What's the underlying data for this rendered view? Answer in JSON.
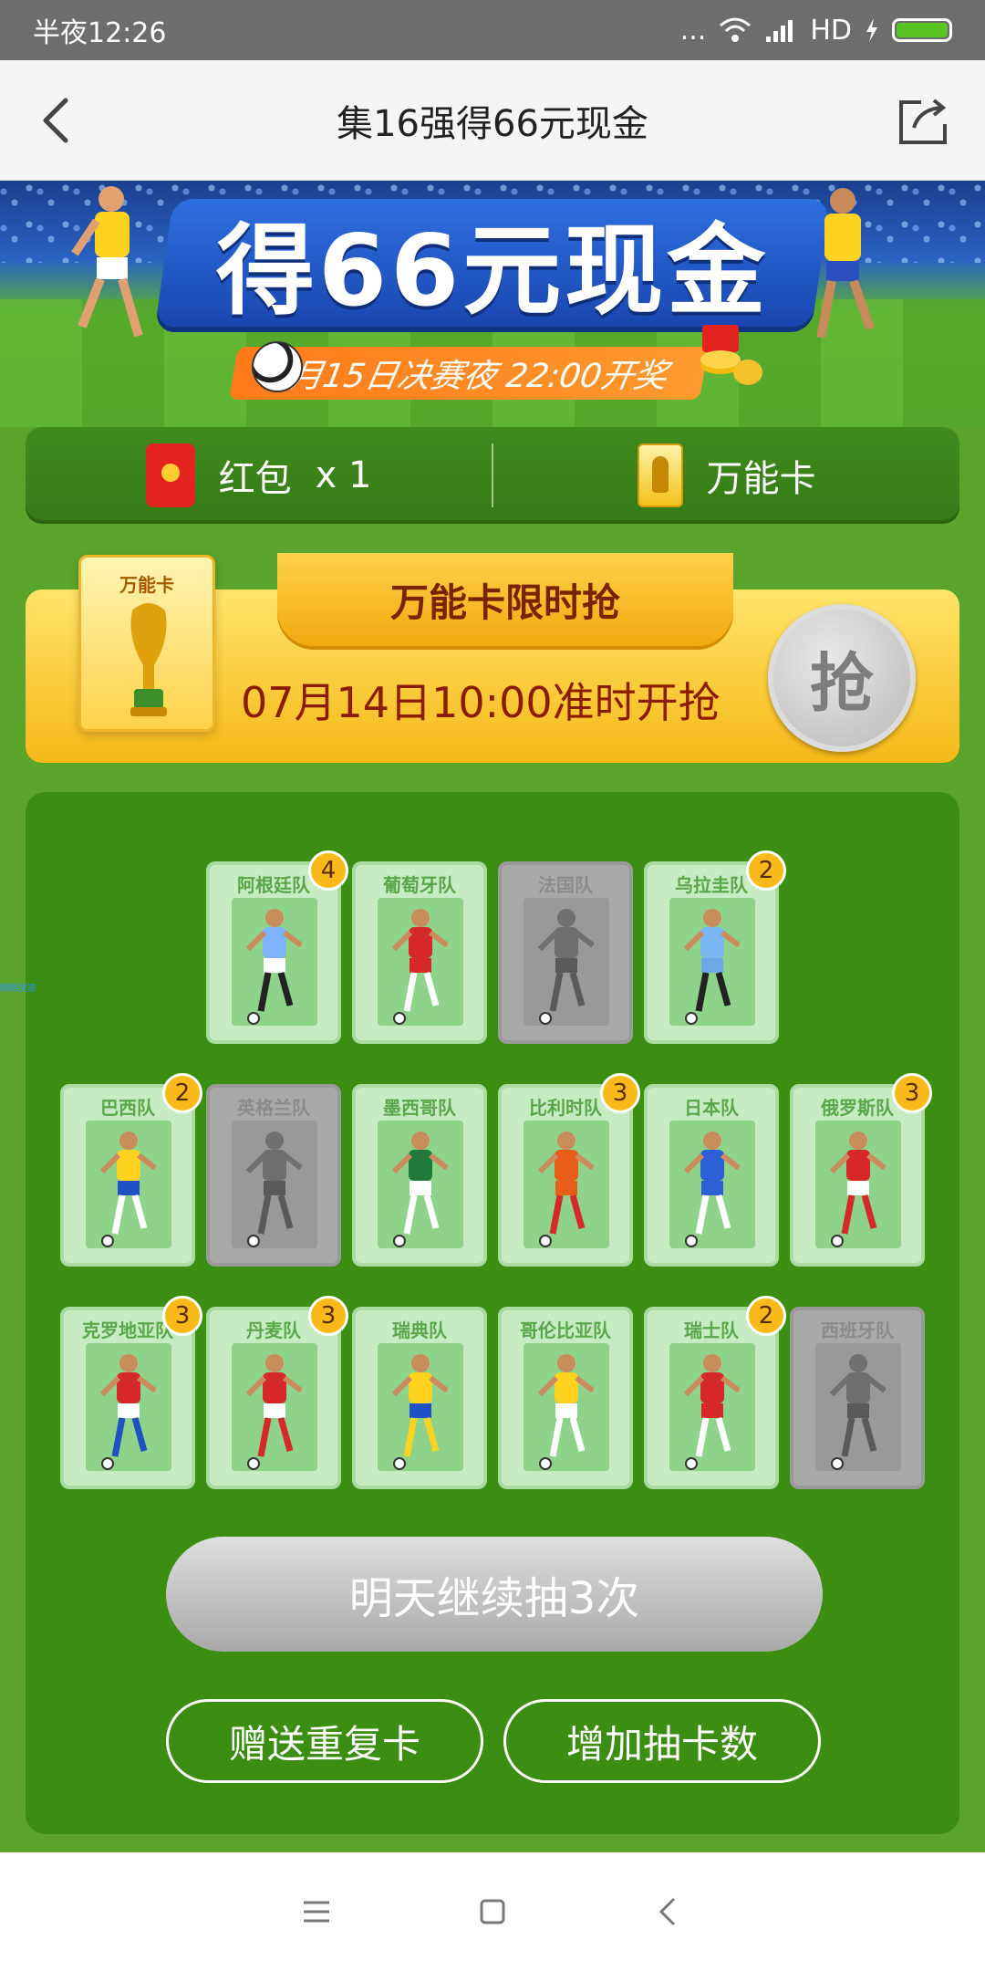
{
  "status": {
    "time": "半夜12:26",
    "dots": "...",
    "network": "HD"
  },
  "header": {
    "title": "集16强得66元现金"
  },
  "banner": {
    "title": "得66元现金",
    "subtitle": "7月15日决赛夜 22:00开奖"
  },
  "inventory": {
    "redpacket_label": "红包",
    "redpacket_count": "x 1",
    "wildcard_label": "万能卡"
  },
  "wildcard": {
    "card_label": "万能卡",
    "tab_title": "万能卡限时抢",
    "time_text": "07月14日10:00准时开抢",
    "grab_label": "抢"
  },
  "teams": [
    {
      "name": "阿根廷队",
      "count": "4",
      "owned": true
    },
    {
      "name": "葡萄牙队",
      "count": "",
      "owned": true
    },
    {
      "name": "法国队",
      "count": "",
      "owned": false
    },
    {
      "name": "乌拉圭队",
      "count": "2",
      "owned": true
    },
    {
      "name": "巴西队",
      "count": "2",
      "owned": true
    },
    {
      "name": "英格兰队",
      "count": "",
      "owned": false
    },
    {
      "name": "墨西哥队",
      "count": "",
      "owned": true
    },
    {
      "name": "比利时队",
      "count": "3",
      "owned": true
    },
    {
      "name": "日本队",
      "count": "",
      "owned": true
    },
    {
      "name": "俄罗斯队",
      "count": "3",
      "owned": true
    },
    {
      "name": "克罗地亚队",
      "count": "3",
      "owned": true
    },
    {
      "name": "丹麦队",
      "count": "3",
      "owned": true
    },
    {
      "name": "瑞典队",
      "count": "",
      "owned": true
    },
    {
      "name": "哥伦比亚队",
      "count": "",
      "owned": true
    },
    {
      "name": "瑞士队",
      "count": "2",
      "owned": true
    },
    {
      "name": "西班牙队",
      "count": "",
      "owned": false
    }
  ],
  "actions": {
    "draw_label": "明天继续抽3次",
    "gift_label": "赠送重复卡",
    "add_label": "增加抽卡数"
  },
  "side_text": "网络状态",
  "colors": {
    "accent_green": "#3b8e12",
    "gold": "#f6b818",
    "badge": "#f9b91a"
  }
}
